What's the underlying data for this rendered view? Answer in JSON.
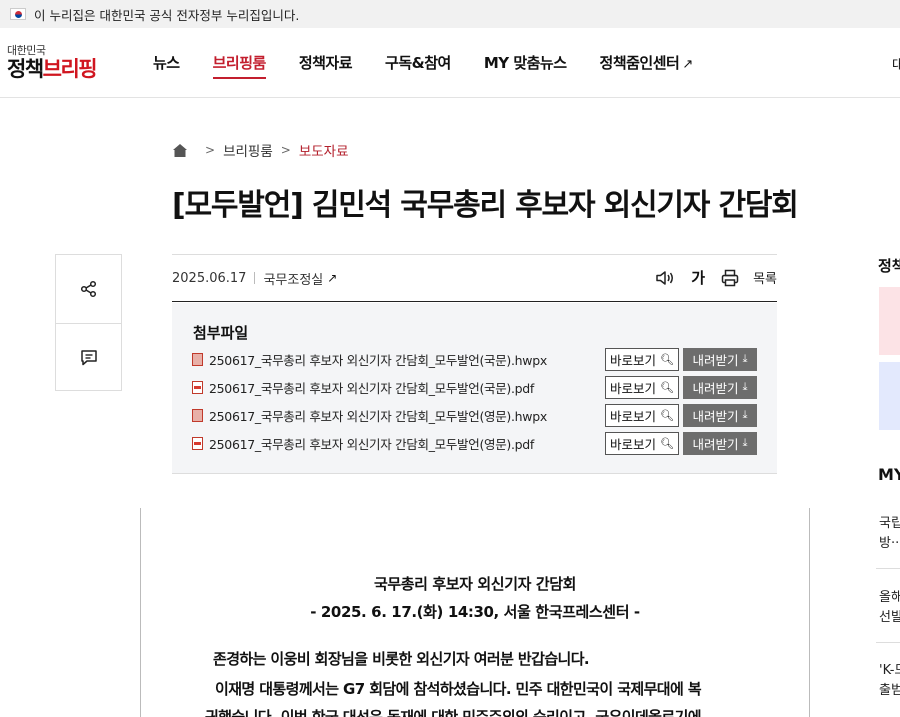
{
  "banner": {
    "text": "이 누리집은 대한민국 공식 전자정부 누리집입니다."
  },
  "logo": {
    "small": "대한민국",
    "big_a": "정책",
    "big_b": "브리핑"
  },
  "nav": {
    "items": [
      "뉴스",
      "브리핑룸",
      "정책자료",
      "구독&참여",
      "MY 맞춤뉴스",
      "정책줌인센터"
    ],
    "external_mark": "↗",
    "clipped": "대"
  },
  "breadcrumb": {
    "items": [
      "브리핑룸",
      "보도자료"
    ],
    "sep": ">"
  },
  "article": {
    "title": "[모두발언] 김민석 국무총리 후보자 외신기자 간담회",
    "date": "2025.06.17",
    "department": "국무조정실",
    "ext_mark": "↗",
    "tools": {
      "font": "가",
      "list": "목록"
    }
  },
  "attachments": {
    "title": "첨부파일",
    "view_label": "바로보기",
    "download_label": "내려받기",
    "files": [
      {
        "name": "250617_국무총리 후보자 외신기자 간담회_모두발언(국문).hwpx",
        "type": "hwp"
      },
      {
        "name": "250617_국무총리 후보자 외신기자 간담회_모두발언(국문).pdf",
        "type": "pdf"
      },
      {
        "name": "250617_국무총리 후보자 외신기자 간담회_모두발언(영문).hwpx",
        "type": "hwp"
      },
      {
        "name": "250617_국무총리 후보자 외신기자 간담회_모두발언(영문).pdf",
        "type": "pdf"
      }
    ]
  },
  "doc": {
    "head1": "국무총리 후보자 외신기자 간담회",
    "head2": "- 2025. 6. 17.(화) 14:30, 서울 한국프레스센터 -",
    "p1": "존경하는 이웅비 회장님을 비롯한 외신기자 여러분 반갑습니다.",
    "p2": "이재명 대통령께서는 G7 회담에 참석하셨습니다. 민주 대한민국이 국제무대에 복",
    "p3": "귀했습니다. 이번 한국 대선은 독재에 대한 민주주의의 승리이고, 국우이데올로기에"
  },
  "sidebar": {
    "title": "정책",
    "my_title": "MY",
    "items": [
      {
        "line1": "국립",
        "line2": "방··"
      },
      {
        "line1": "올해",
        "line2": "선발"
      },
      {
        "line1": "'K-드",
        "line2": "출범"
      }
    ]
  },
  "colors": {
    "accent": "#c31f2e",
    "download_btn": "#6d6d6d",
    "attach_bg": "#f4f5f7"
  }
}
